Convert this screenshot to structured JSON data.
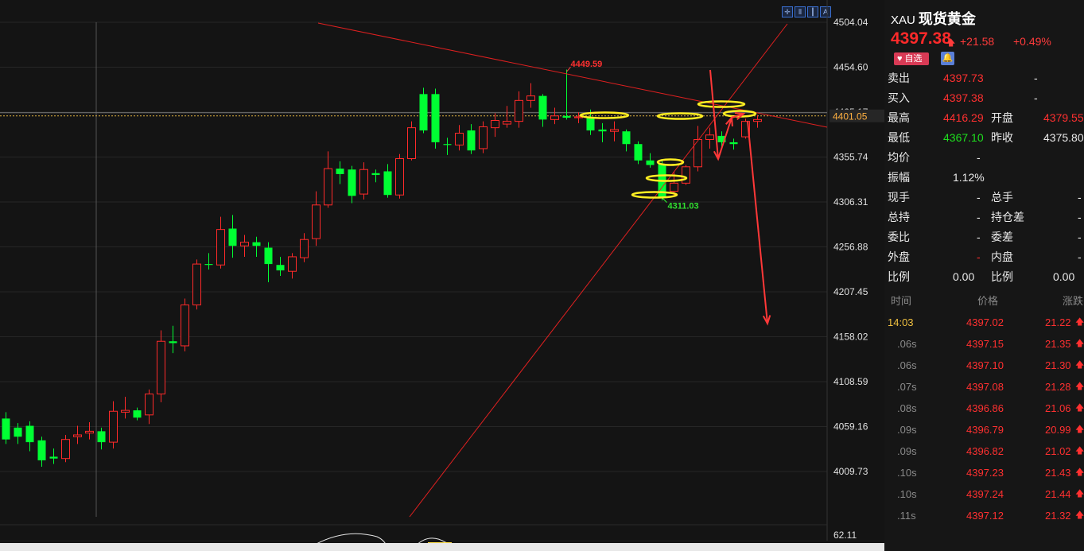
{
  "toolbar": {
    "icons": [
      "crosshair-icon",
      "bar-icon",
      "candle-icon",
      "text-icon"
    ]
  },
  "chart_data": {
    "type": "candlestick",
    "y_ticks": [
      "4504.04",
      "4454.60",
      "4405.17",
      "4355.74",
      "4306.31",
      "4256.88",
      "4207.45",
      "4158.02",
      "4108.59",
      "4059.16",
      "4009.73"
    ],
    "y_tick_values": [
      4504.04,
      4454.6,
      4405.17,
      4355.74,
      4306.31,
      4256.88,
      4207.45,
      4158.02,
      4108.59,
      4059.16,
      4009.73
    ],
    "volume_tick": "62.11",
    "current_price_label": "4401.05",
    "current_price": 4401.05,
    "high_label": "4449.59",
    "high_value": 4449.59,
    "low_label": "4311.03",
    "low_value": 4311.03,
    "candles": [
      {
        "o": 4068,
        "c": 4045,
        "h": 4075,
        "l": 4040
      },
      {
        "o": 4058,
        "c": 4048,
        "h": 4063,
        "l": 4040
      },
      {
        "o": 4060,
        "c": 4042,
        "h": 4065,
        "l": 4032
      },
      {
        "o": 4044,
        "c": 4022,
        "h": 4048,
        "l": 4015
      },
      {
        "o": 4026,
        "c": 4024,
        "h": 4035,
        "l": 4018
      },
      {
        "o": 4024,
        "c": 4045,
        "h": 4050,
        "l": 4020
      },
      {
        "o": 4048,
        "c": 4050,
        "h": 4060,
        "l": 4040
      },
      {
        "o": 4052,
        "c": 4054,
        "h": 4064,
        "l": 4045
      },
      {
        "o": 4054,
        "c": 4042,
        "h": 4058,
        "l": 4034
      },
      {
        "o": 4042,
        "c": 4076,
        "h": 4087,
        "l": 4035
      },
      {
        "o": 4075,
        "c": 4077,
        "h": 4092,
        "l": 4068
      },
      {
        "o": 4077,
        "c": 4069,
        "h": 4080,
        "l": 4066
      },
      {
        "o": 4072,
        "c": 4095,
        "h": 4100,
        "l": 4062
      },
      {
        "o": 4095,
        "c": 4153,
        "h": 4165,
        "l": 4086
      },
      {
        "o": 4153,
        "c": 4151,
        "h": 4170,
        "l": 4140
      },
      {
        "o": 4148,
        "c": 4193,
        "h": 4200,
        "l": 4142
      },
      {
        "o": 4193,
        "c": 4238,
        "h": 4243,
        "l": 4188
      },
      {
        "o": 4238,
        "c": 4237,
        "h": 4250,
        "l": 4232
      },
      {
        "o": 4237,
        "c": 4276,
        "h": 4290,
        "l": 4233
      },
      {
        "o": 4277,
        "c": 4258,
        "h": 4292,
        "l": 4245
      },
      {
        "o": 4258,
        "c": 4262,
        "h": 4270,
        "l": 4246
      },
      {
        "o": 4262,
        "c": 4258,
        "h": 4268,
        "l": 4246
      },
      {
        "o": 4256,
        "c": 4238,
        "h": 4262,
        "l": 4218
      },
      {
        "o": 4237,
        "c": 4231,
        "h": 4246,
        "l": 4225
      },
      {
        "o": 4230,
        "c": 4246,
        "h": 4250,
        "l": 4222
      },
      {
        "o": 4245,
        "c": 4265,
        "h": 4272,
        "l": 4240
      },
      {
        "o": 4266,
        "c": 4303,
        "h": 4318,
        "l": 4258
      },
      {
        "o": 4303,
        "c": 4343,
        "h": 4362,
        "l": 4300
      },
      {
        "o": 4343,
        "c": 4337,
        "h": 4351,
        "l": 4326
      },
      {
        "o": 4342,
        "c": 4313,
        "h": 4346,
        "l": 4305
      },
      {
        "o": 4315,
        "c": 4342,
        "h": 4350,
        "l": 4309
      },
      {
        "o": 4338,
        "c": 4336,
        "h": 4342,
        "l": 4328
      },
      {
        "o": 4340,
        "c": 4314,
        "h": 4348,
        "l": 4311
      },
      {
        "o": 4314,
        "c": 4354,
        "h": 4359,
        "l": 4310
      },
      {
        "o": 4354,
        "c": 4388,
        "h": 4395,
        "l": 4352
      },
      {
        "o": 4425,
        "c": 4385,
        "h": 4432,
        "l": 4382
      },
      {
        "o": 4425,
        "c": 4372,
        "h": 4431,
        "l": 4365
      },
      {
        "o": 4370,
        "c": 4369,
        "h": 4377,
        "l": 4358
      },
      {
        "o": 4369,
        "c": 4382,
        "h": 4391,
        "l": 4363
      },
      {
        "o": 4385,
        "c": 4363,
        "h": 4392,
        "l": 4359
      },
      {
        "o": 4365,
        "c": 4389,
        "h": 4395,
        "l": 4360
      },
      {
        "o": 4388,
        "c": 4396,
        "h": 4404,
        "l": 4378
      },
      {
        "o": 4392,
        "c": 4395,
        "h": 4412,
        "l": 4388
      },
      {
        "o": 4395,
        "c": 4418,
        "h": 4428,
        "l": 4388
      },
      {
        "o": 4418,
        "c": 4423,
        "h": 4437,
        "l": 4410
      },
      {
        "o": 4423,
        "c": 4397,
        "h": 4425,
        "l": 4389
      },
      {
        "o": 4397,
        "c": 4401,
        "h": 4410,
        "l": 4392
      },
      {
        "o": 4401,
        "c": 4399,
        "h": 4452,
        "l": 4397
      },
      {
        "o": 4399,
        "c": 4400,
        "h": 4405,
        "l": 4393
      },
      {
        "o": 4400,
        "c": 4385,
        "h": 4408,
        "l": 4380
      },
      {
        "o": 4386,
        "c": 4384,
        "h": 4393,
        "l": 4372
      },
      {
        "o": 4384,
        "c": 4386,
        "h": 4395,
        "l": 4373
      },
      {
        "o": 4384,
        "c": 4370,
        "h": 4386,
        "l": 4362
      },
      {
        "o": 4370,
        "c": 4352,
        "h": 4373,
        "l": 4348
      },
      {
        "o": 4352,
        "c": 4347,
        "h": 4360,
        "l": 4344
      },
      {
        "o": 4348,
        "c": 4311,
        "h": 4352,
        "l": 4308
      },
      {
        "o": 4318,
        "c": 4327,
        "h": 4340,
        "l": 4312
      },
      {
        "o": 4327,
        "c": 4345,
        "h": 4347,
        "l": 4325
      },
      {
        "o": 4345,
        "c": 4375,
        "h": 4390,
        "l": 4340
      },
      {
        "o": 4375,
        "c": 4380,
        "h": 4388,
        "l": 4365
      },
      {
        "o": 4379,
        "c": 4372,
        "h": 4384,
        "l": 4365
      },
      {
        "o": 4372,
        "c": 4370,
        "h": 4376,
        "l": 4364
      },
      {
        "o": 4378,
        "c": 4395,
        "h": 4398,
        "l": 4376
      },
      {
        "o": 4395,
        "c": 4397,
        "h": 4402,
        "l": 4388
      }
    ]
  },
  "quote": {
    "symbol": "XAU",
    "name": "现货黄金",
    "price": "4397.38",
    "change": "+21.58",
    "percent": "+0.49%",
    "watch_label": "自选",
    "rows": [
      {
        "l1": "卖出",
        "v1": "4397.73",
        "c1": "red",
        "l2": "",
        "v2": "-",
        "c2": "white"
      },
      {
        "l1": "买入",
        "v1": "4397.38",
        "c1": "red",
        "l2": "",
        "v2": "-",
        "c2": "white"
      },
      {
        "l1": "最高",
        "v1": "4416.29",
        "c1": "red",
        "l2": "开盘",
        "v2": "4379.55",
        "c2": "red"
      },
      {
        "l1": "最低",
        "v1": "4367.10",
        "c1": "green",
        "l2": "昨收",
        "v2": "4375.80",
        "c2": "white"
      },
      {
        "l1": "均价",
        "v1": "-",
        "c1": "white",
        "l2": "",
        "v2": "",
        "c2": "white"
      },
      {
        "l1": "振幅",
        "v1": "1.12%",
        "c1": "white",
        "l2": "",
        "v2": "",
        "c2": "white"
      },
      {
        "l1": "现手",
        "v1": "-",
        "c1": "white",
        "l2": "总手",
        "v2": "-",
        "c2": "white"
      },
      {
        "l1": "总持",
        "v1": "-",
        "c1": "white",
        "l2": "持仓差",
        "v2": "-",
        "c2": "white"
      },
      {
        "l1": "委比",
        "v1": "-",
        "c1": "white",
        "l2": "委差",
        "v2": "-",
        "c2": "white"
      },
      {
        "l1": "外盘",
        "v1": "-",
        "c1": "red",
        "l2": "内盘",
        "v2": "-",
        "c2": "white"
      },
      {
        "l1": "比例",
        "v1": "0.00",
        "c1": "white",
        "l2": "比例",
        "v2": "0.00",
        "c2": "white"
      }
    ]
  },
  "ticks": {
    "headers": [
      "时间",
      "价格",
      "涨跌"
    ],
    "rows": [
      {
        "time": "14:03",
        "price": "4397.02",
        "chg": "21.22"
      },
      {
        "time": ".06s",
        "price": "4397.15",
        "chg": "21.35"
      },
      {
        "time": ".06s",
        "price": "4397.10",
        "chg": "21.30"
      },
      {
        "time": ".07s",
        "price": "4397.08",
        "chg": "21.28"
      },
      {
        "time": ".08s",
        "price": "4396.86",
        "chg": "21.06"
      },
      {
        "time": ".09s",
        "price": "4396.79",
        "chg": "20.99"
      },
      {
        "time": ".09s",
        "price": "4396.82",
        "chg": "21.02"
      },
      {
        "time": ".10s",
        "price": "4397.23",
        "chg": "21.43"
      },
      {
        "time": ".10s",
        "price": "4397.24",
        "chg": "21.44"
      },
      {
        "time": ".11s",
        "price": "4397.12",
        "chg": "21.32"
      }
    ]
  }
}
